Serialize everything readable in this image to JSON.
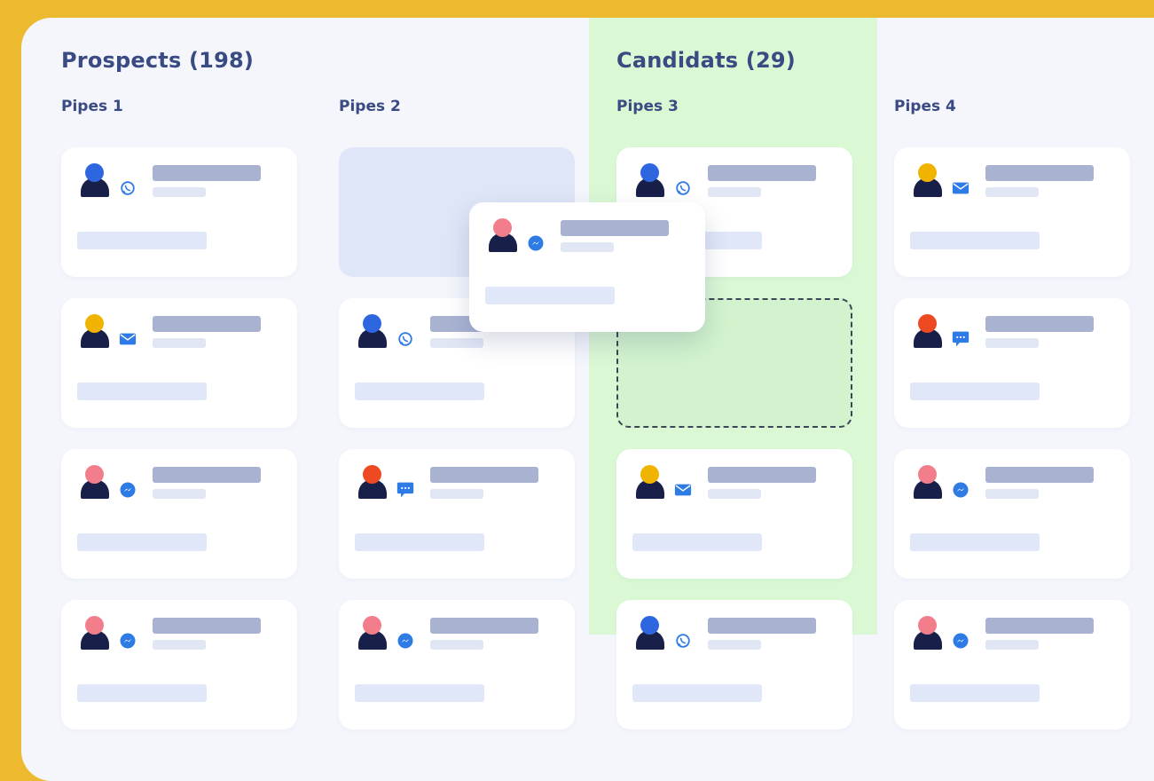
{
  "groups": {
    "prospects": {
      "label": "Prospects (198)"
    },
    "candidats": {
      "label": "Candidats (29)"
    }
  },
  "pipes": [
    {
      "label": "Pipes 1"
    },
    {
      "label": "Pipes 2"
    },
    {
      "label": "Pipes 3"
    },
    {
      "label": "Pipes 4"
    }
  ],
  "colors": {
    "frame": "#EDB92E",
    "board": "#F4F6FC",
    "candidats_column": "#DAF8D4",
    "heading": "#3A4A83",
    "avatar_blue": "#2E66E0",
    "avatar_yellow": "#F0B400",
    "avatar_pink": "#F27E8C",
    "avatar_red": "#EE4A22",
    "channel_icon": "#2E7BE6"
  },
  "cards": [
    {
      "pipe": 1,
      "avatar": "blue",
      "channel": "whatsapp-icon"
    },
    {
      "pipe": 1,
      "avatar": "yellow",
      "channel": "mail-icon"
    },
    {
      "pipe": 1,
      "avatar": "pink",
      "channel": "messenger-icon"
    },
    {
      "pipe": 1,
      "avatar": "pink",
      "channel": "messenger-icon"
    },
    {
      "pipe": 2,
      "state": "placeholder"
    },
    {
      "pipe": 2,
      "avatar": "blue",
      "channel": "whatsapp-icon"
    },
    {
      "pipe": 2,
      "avatar": "red",
      "channel": "chat-icon"
    },
    {
      "pipe": 2,
      "avatar": "pink",
      "channel": "messenger-icon"
    },
    {
      "pipe": 3,
      "avatar": "blue",
      "channel": "whatsapp-icon"
    },
    {
      "pipe": 3,
      "state": "dropzone"
    },
    {
      "pipe": 3,
      "avatar": "yellow",
      "channel": "mail-icon"
    },
    {
      "pipe": 3,
      "avatar": "blue",
      "channel": "whatsapp-icon"
    },
    {
      "pipe": 4,
      "avatar": "yellow",
      "channel": "mail-icon"
    },
    {
      "pipe": 4,
      "avatar": "red",
      "channel": "chat-icon"
    },
    {
      "pipe": 4,
      "avatar": "pink",
      "channel": "messenger-icon"
    },
    {
      "pipe": 4,
      "avatar": "pink",
      "channel": "messenger-icon"
    },
    {
      "state": "dragging",
      "avatar": "pink",
      "channel": "messenger-icon"
    }
  ]
}
